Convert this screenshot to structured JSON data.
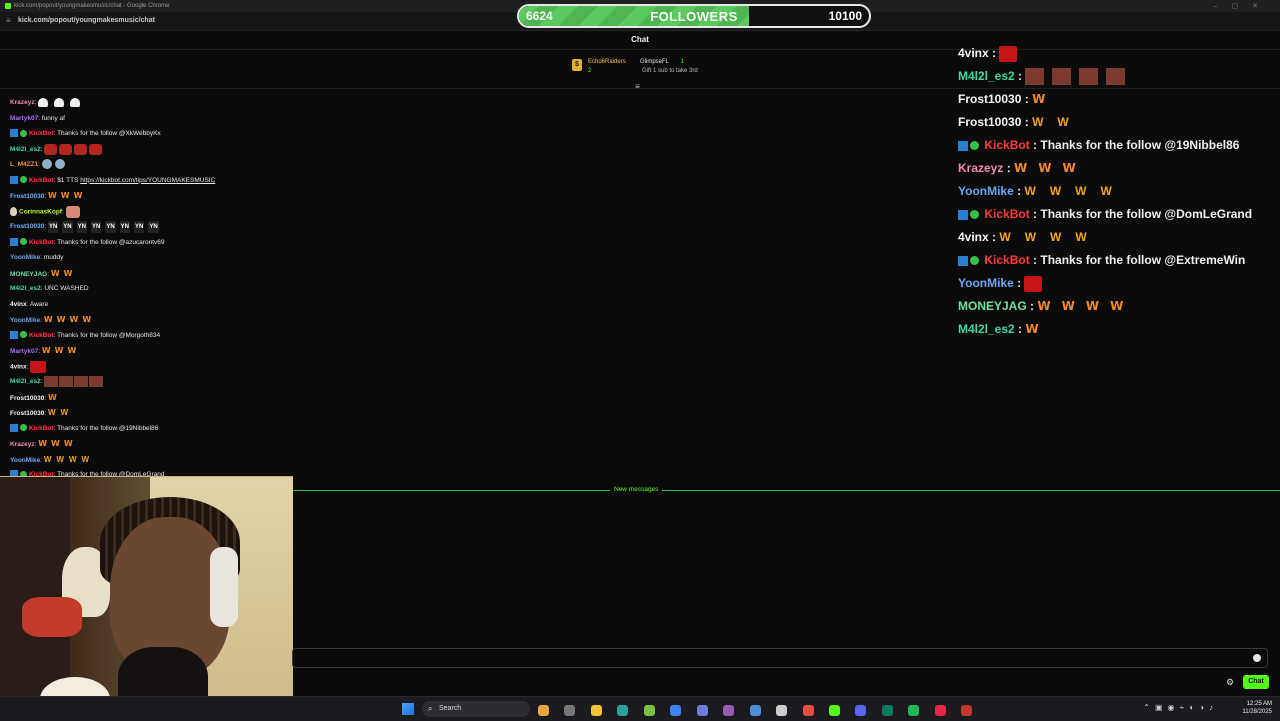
{
  "browser": {
    "title": "kick.com/popout/youngmakesmusic/chat - Google Chrome",
    "url": "kick.com/popout/youngmakesmusic/chat"
  },
  "goal": {
    "current": "6624",
    "label": "FOLLOWERS",
    "target": "10100",
    "progress": 0.656
  },
  "chat": {
    "header": "Chat",
    "pinned": [
      {
        "name": "Echo6Raiders",
        "count": "2"
      },
      {
        "name": "GlimpseFL",
        "count": "1",
        "sub": "Gift 1 sub to take 3rd"
      }
    ],
    "new_messages_label": "New messages",
    "send_label": "Chat"
  },
  "left_messages": [
    {
      "user": "Krazeyz",
      "sep": ":",
      "text": ""
    },
    {
      "user": "Martyk07",
      "sep": ":",
      "text": "funny af"
    },
    {
      "user": "KickBot",
      "sep": ":",
      "text": "Thanks for the follow @XkWebbyKx"
    },
    {
      "user": "M4l2l_es2",
      "sep": ":",
      "text": ""
    },
    {
      "user": "L_M4ZZ1",
      "sep": ":",
      "text": ""
    },
    {
      "user": "KickBot",
      "sep": ":",
      "text": "$1 TTS",
      "link": "https://kickbot.com/tips/YOUNGMAKESMUSIC"
    },
    {
      "user": "Frost10030",
      "sep": ":",
      "text": ""
    },
    {
      "user": "CorinnasKopf",
      "sep": ":",
      "text": ""
    },
    {
      "user": "Frost10030",
      "sep": ":",
      "text": ""
    },
    {
      "user": "KickBot",
      "sep": ":",
      "text": "Thanks for the follow @azucarontv69"
    },
    {
      "user": "YoonMike",
      "sep": ":",
      "text": "muddy"
    },
    {
      "user": "MONEYJAG",
      "sep": ":",
      "text": ""
    },
    {
      "user": "M4l2l_es2",
      "sep": ":",
      "text": "UNC WASHED"
    },
    {
      "user": "4vinx",
      "sep": ":",
      "text": "Aware"
    },
    {
      "user": "YoonMike",
      "sep": ":",
      "text": ""
    },
    {
      "user": "KickBot",
      "sep": ":",
      "text": "Thanks for the follow @Morgoth834"
    },
    {
      "user": "Martyk07",
      "sep": ":",
      "text": ""
    },
    {
      "user": "4vinx",
      "sep": ":",
      "text": ""
    },
    {
      "user": "M4l2l_es2",
      "sep": ":",
      "text": ""
    },
    {
      "user": "Frost10030",
      "sep": ":",
      "text": ""
    },
    {
      "user": "Frost10030",
      "sep": ":",
      "text": ""
    },
    {
      "user": "KickBot",
      "sep": ":",
      "text": "Thanks for the follow @19Nibbel86"
    },
    {
      "user": "Krazeyz",
      "sep": ":",
      "text": ""
    },
    {
      "user": "YoonMike",
      "sep": ":",
      "text": ""
    },
    {
      "user": "KickBot",
      "sep": ":",
      "text": "Thanks for the follow @DomLeGrand"
    }
  ],
  "yn_badge": "YN",
  "w_emote": "W",
  "right_messages": [
    {
      "user": "4vinx",
      "sep": " :",
      "text": ""
    },
    {
      "user": "M4l2l_es2",
      "sep": " :",
      "text": ""
    },
    {
      "user": "Frost10030",
      "sep": " :",
      "text": ""
    },
    {
      "user": "Frost10030",
      "sep": " :",
      "text": ""
    },
    {
      "user": "KickBot",
      "sep": " :",
      "text": "Thanks for the follow @19Nibbel86"
    },
    {
      "user": "Krazeyz",
      "sep": " :",
      "text": ""
    },
    {
      "user": "YoonMike",
      "sep": " :",
      "text": ""
    },
    {
      "user": "KickBot",
      "sep": " :",
      "text": "Thanks for the follow @DomLeGrand"
    },
    {
      "user": "4vinx",
      "sep": " :",
      "text": ""
    },
    {
      "user": "KickBot",
      "sep": " :",
      "text": "Thanks for the follow @ExtremeWin"
    },
    {
      "user": "YoonMike",
      "sep": " :",
      "text": ""
    },
    {
      "user": "MONEYJAG",
      "sep": " :",
      "text": ""
    },
    {
      "user": "M4l2l_es2",
      "sep": " :",
      "text": ""
    }
  ],
  "taskbar": {
    "search_label": "Search",
    "time": "12:25 AM",
    "date": "11/28/2025"
  },
  "colors": {
    "accent": "#53fc18",
    "goal_fill": "#5bc95d",
    "kickbot": "#ff3b3b"
  }
}
